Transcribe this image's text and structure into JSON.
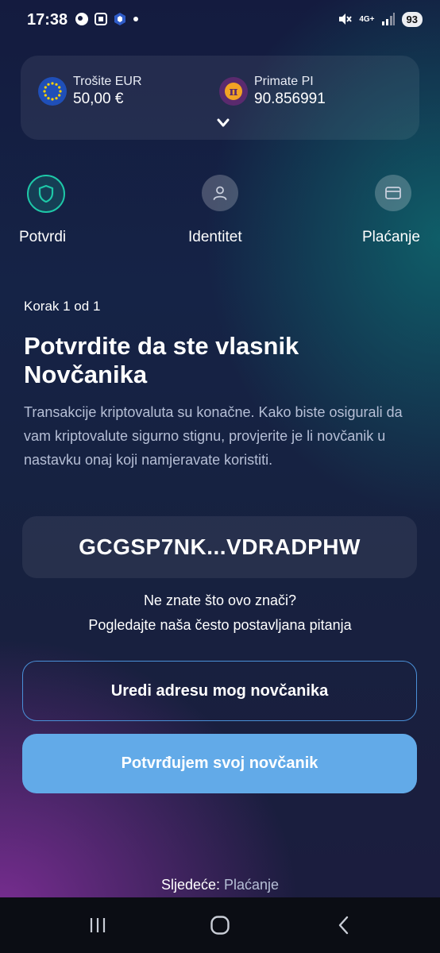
{
  "status_bar": {
    "time": "17:38",
    "network": "4G+",
    "battery": "93"
  },
  "summary": {
    "spend": {
      "label": "Trošite EUR",
      "value": "50,00 €",
      "icon": "eu-flag-icon"
    },
    "receive": {
      "label": "Primate PI",
      "value": "90.856991",
      "icon": "pi-coin-icon"
    }
  },
  "steps": [
    {
      "label": "Potvrdi",
      "icon": "shield-icon",
      "active": true
    },
    {
      "label": "Identitet",
      "icon": "person-icon",
      "active": false
    },
    {
      "label": "Plaćanje",
      "icon": "card-icon",
      "active": false
    }
  ],
  "content": {
    "step_counter": "Korak 1 od 1",
    "title_line1": "Potvrdite da ste vlasnik",
    "title_line2": "Novčanika",
    "description": "Transakcije kriptovaluta su konačne. Kako biste osigurali da vam kriptovalute sigurno stignu, provjerite je li novčanik u nastavku onaj koji namjeravate koristiti.",
    "wallet_address": "GCGSP7NK...VDRADPHW",
    "help_question": "Ne znate što ovo znači?",
    "help_link": "Pogledajte naša često postavljana pitanja"
  },
  "buttons": {
    "edit_address": "Uredi adresu mog novčanika",
    "confirm_wallet": "Potvrđujem svoj novčanik"
  },
  "footer": {
    "next_prefix": "Sljedeće:",
    "next_step": "Plaćanje"
  },
  "colors": {
    "accent_teal": "#1ec8a8",
    "button_primary": "#62aae8",
    "button_outline": "#4a90d8"
  }
}
